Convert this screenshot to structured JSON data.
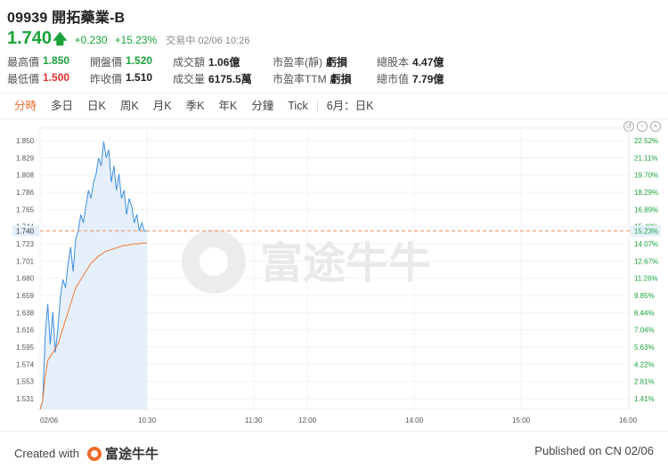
{
  "stock": {
    "code_name": "09939 開拓藥業-B",
    "price": "1.740",
    "change": "+0.230",
    "change_pct": "+15.23%",
    "status": "交易中 02/06 10:26"
  },
  "stats_row1": [
    {
      "label": "最高價",
      "value": "1.850",
      "tone": "green"
    },
    {
      "label": "開盤價",
      "value": "1.520",
      "tone": "green"
    },
    {
      "label": "成交額",
      "value": "1.06億",
      "tone": ""
    },
    {
      "label": "市盈率(靜)",
      "value": "虧損",
      "tone": ""
    },
    {
      "label": "總股本",
      "value": "4.47億",
      "tone": ""
    }
  ],
  "stats_row2": [
    {
      "label": "最低價",
      "value": "1.500",
      "tone": "red"
    },
    {
      "label": "昨收價",
      "value": "1.510",
      "tone": ""
    },
    {
      "label": "成交量",
      "value": "6175.5萬",
      "tone": ""
    },
    {
      "label": "市盈率TTM",
      "value": "虧損",
      "tone": ""
    },
    {
      "label": "總市值",
      "value": "7.79億",
      "tone": ""
    }
  ],
  "tabs": [
    "分時",
    "多日",
    "日K",
    "周K",
    "月K",
    "季K",
    "年K",
    "分鐘",
    "Tick",
    "6月：日K"
  ],
  "active_tab": 0,
  "chart_data": {
    "type": "line",
    "y_ticks": [
      "1.850",
      "1.829",
      "1.808",
      "1.786",
      "1.765",
      "1.744",
      "1.723",
      "1.701",
      "1.680",
      "1.659",
      "1.638",
      "1.616",
      "1.595",
      "1.574",
      "1.553",
      "1.531"
    ],
    "pct_ticks": [
      "22.52%",
      "21.11%",
      "19.70%",
      "18.29%",
      "16.89%",
      "15.48%",
      "14.07%",
      "12.67%",
      "11.26%",
      "9.85%",
      "8.44%",
      "7.04%",
      "5.63%",
      "4.22%",
      "2.81%",
      "1.41%"
    ],
    "x_ticks": [
      "02/06",
      "10:30",
      "11:30",
      "12:00",
      "14:00",
      "15:00",
      "16:00"
    ],
    "ylim": [
      1.52,
      1.86
    ],
    "current_price_label": "1.740",
    "current_pct_label": "15.23%",
    "current_price": 1.74,
    "series": [
      {
        "values": [
          1.52,
          1.53,
          1.61,
          1.65,
          1.6,
          1.64,
          1.59,
          1.62,
          1.66,
          1.68,
          1.67,
          1.7,
          1.72,
          1.69,
          1.73,
          1.74,
          1.76,
          1.75,
          1.77,
          1.79,
          1.78,
          1.8,
          1.81,
          1.83,
          1.82,
          1.85,
          1.83,
          1.84,
          1.8,
          1.82,
          1.79,
          1.81,
          1.78,
          1.79,
          1.76,
          1.78,
          1.77,
          1.75,
          1.76,
          1.74,
          1.75,
          1.74,
          1.74
        ]
      },
      {
        "values": [
          1.52,
          1.53,
          1.56,
          1.58,
          1.585,
          1.59,
          1.595,
          1.6,
          1.61,
          1.62,
          1.63,
          1.64,
          1.65,
          1.66,
          1.67,
          1.675,
          1.68,
          1.685,
          1.69,
          1.695,
          1.7,
          1.703,
          1.706,
          1.709,
          1.711,
          1.713,
          1.715,
          1.716,
          1.717,
          1.718,
          1.719,
          1.72,
          1.721,
          1.722,
          1.722,
          1.723,
          1.723,
          1.724,
          1.724,
          1.724,
          1.725,
          1.725,
          1.725
        ]
      }
    ]
  },
  "watermark": "富途牛牛",
  "footer": {
    "created_with": "Created with",
    "brand": "富途牛牛",
    "published": "Published on CN 02/06"
  },
  "colors": {
    "up": "#1aa33a",
    "down": "#e0302f",
    "price_line": "#3d8fe0",
    "avg_line": "#f0792a",
    "fill": "#dbe9fb",
    "accent": "#f06b2a"
  }
}
